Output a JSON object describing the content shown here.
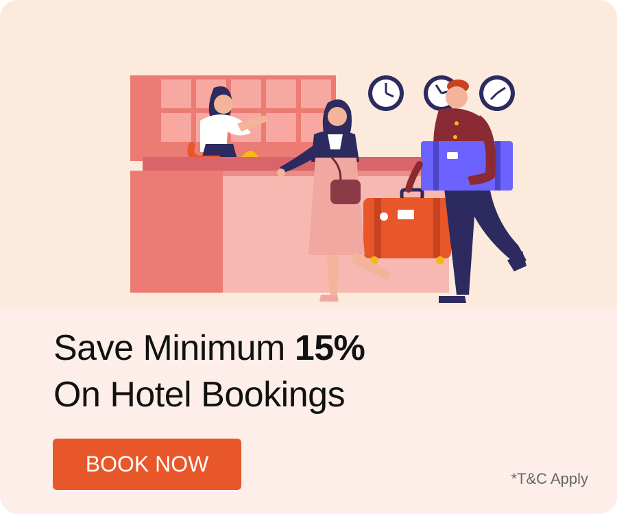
{
  "promo": {
    "headline_prefix": "Save Minimum ",
    "headline_highlight": "15%",
    "headline_line2": "On Hotel Bookings",
    "button_label": "BOOK NOW",
    "terms": "*T&C Apply"
  },
  "illustration": {
    "subject": "hotel-reception-with-receptionist-guest-and-bellboy"
  },
  "colors": {
    "hero_background": "#fcebdd",
    "card_background": "#fdeee9",
    "button": "#e8572a",
    "button_text": "#ffffff",
    "headline_text": "#111111",
    "terms_text": "#666666",
    "accent_salmon": "#ec7b74",
    "accent_navy": "#2c2a5e",
    "accent_purple": "#6c63ff"
  }
}
